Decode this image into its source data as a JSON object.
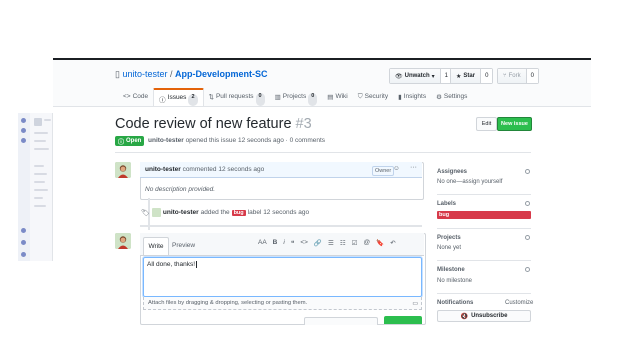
{
  "repo": {
    "owner": "unito-tester",
    "separator": " / ",
    "name": "App-Development-SC"
  },
  "actions": {
    "unwatch": {
      "label": "Unwatch",
      "count": "1"
    },
    "star": {
      "label": "Star",
      "count": "0"
    },
    "fork": {
      "label": "Fork",
      "count": "0"
    }
  },
  "tabs": [
    {
      "label": "Code",
      "icon": "code-icon"
    },
    {
      "label": "Issues",
      "count": "2",
      "icon": "issue-icon"
    },
    {
      "label": "Pull requests",
      "count": "0",
      "icon": "pull-request-icon"
    },
    {
      "label": "Projects",
      "count": "0",
      "icon": "project-icon"
    },
    {
      "label": "Wiki",
      "icon": "book-icon"
    },
    {
      "label": "Security",
      "icon": "shield-icon"
    },
    {
      "label": "Insights",
      "icon": "graph-icon"
    },
    {
      "label": "Settings",
      "icon": "gear-icon"
    }
  ],
  "issue": {
    "title": "Code review of new feature",
    "number": "#3",
    "state": "Open",
    "author": "unito-tester",
    "opened_text": "opened this issue 12 seconds ago · 0 comments",
    "edit_label": "Edit",
    "new_issue_label": "New issue"
  },
  "comment": {
    "author": "unito-tester",
    "meta": "commented 12 seconds ago",
    "owner_badge": "Owner",
    "body": "No description provided."
  },
  "label_event": {
    "actor": "unito-tester",
    "pre": "added the",
    "label": "bug",
    "post": "label 12 seconds ago"
  },
  "composer": {
    "write_tab": "Write",
    "preview_tab": "Preview",
    "text": "All done, thanks!",
    "attach_hint": "Attach files by dragging & dropping, selecting or pasting them.",
    "toolbar": [
      "AA",
      "B",
      "i",
      "❝",
      "<>",
      "🔗",
      "☰",
      "☷",
      "☑",
      "@",
      "🔖",
      "↶"
    ]
  },
  "sidebar": {
    "assignees": {
      "heading": "Assignees",
      "value": "No one—assign yourself"
    },
    "labels": {
      "heading": "Labels",
      "value": "bug"
    },
    "projects": {
      "heading": "Projects",
      "value": "None yet"
    },
    "milestone": {
      "heading": "Milestone",
      "value": "No milestone"
    },
    "notifications": {
      "heading": "Notifications",
      "customize": "Customize",
      "unsubscribe": "Unsubscribe"
    }
  },
  "colors": {
    "open": "#28a745",
    "bug": "#d73a4a",
    "link": "#0366d6",
    "issues_tab_accent": "#e36209"
  }
}
